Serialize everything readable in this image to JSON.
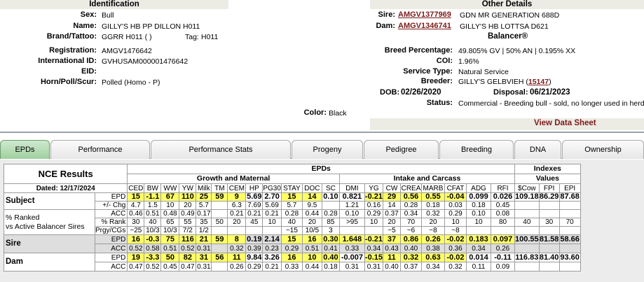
{
  "identification": {
    "header": "Identification",
    "rows": [
      {
        "label": "Sex:",
        "value": "Bull"
      },
      {
        "label": "Name:",
        "value": "GILLY'S HB PP DILLON H011"
      },
      {
        "label": "Brand/Tattoo:",
        "value": "GGRR H011 ( )",
        "tag_label": "Tag:",
        "tag_value": "H011"
      },
      {
        "label": "Registration:",
        "value": "AMGV1476642"
      },
      {
        "label": "International ID:",
        "value": "GVHUSAM000001476642"
      },
      {
        "label": "EID:",
        "value": ""
      },
      {
        "label": "Horn/Poll/Scur:",
        "value": "Polled (Homo - P)"
      }
    ],
    "color_label": "Color:",
    "color_value": "Black"
  },
  "other": {
    "header": "Other Details",
    "sire_label": "Sire:",
    "sire_id": "AMGV1377969",
    "sire_name": "GDN MR GENERATION 688D",
    "dam_label": "Dam:",
    "dam_id": "AMGV1346741",
    "dam_name": "GILLY'S HB LOTTSA D621",
    "breed_type": "Balancer®",
    "rows": [
      {
        "label": "Breed Percentage:",
        "value": "49.805% GV | 50% AN | 0.195% XX"
      },
      {
        "label": "COI:",
        "value": "1.96%"
      },
      {
        "label": "Service Type:",
        "value": "Natural Service"
      }
    ],
    "breeder_label": "Breeder:",
    "breeder_value": "GILLY'S GELBVIEH (",
    "breeder_link": "15147",
    "breeder_close": ")",
    "dob_label": "DOB:",
    "dob_value": "02/26/2020",
    "disposal_label": "Disposal:",
    "disposal_value": "06/21/2023",
    "status_label": "Status:",
    "status_value": "Commercial - Breeding bull - sold, no longer used in herd",
    "view_link": "View Data Sheet"
  },
  "tabs": [
    "EPDs",
    "Performance",
    "Performance Stats",
    "Progeny",
    "Pedigree",
    "Breeding",
    "DNA",
    "Ownership"
  ],
  "nce": {
    "title": "NCE Results",
    "dated": "Dated: 12/17/2024",
    "epds_header": "EPDs",
    "growth_header": "Growth and Maternal",
    "intake_header": "Intake and Carcass",
    "indexes_header": "Indexes",
    "values_header": "Values",
    "columns": [
      "CED",
      "BW",
      "WW",
      "YW",
      "Milk",
      "TM",
      "CEM",
      "HP",
      "PG30",
      "STAY",
      "DOC",
      "SC",
      "DMI",
      "YG",
      "CW",
      "CREA",
      "MARB",
      "CFAT",
      "ADG",
      "RFI",
      "$Cow",
      "FPI",
      "EPI"
    ],
    "subject_label": "Subject",
    "ranked_label1": "% Ranked",
    "ranked_label2": "vs Active Balancer Sires",
    "row_labels": {
      "epd": "EPD",
      "chg": "+/- Chg",
      "acc": "ACC",
      "rank": "% Rank",
      "prgy": "Prgy/CGs"
    },
    "subject": {
      "epd": [
        "15",
        "-1.1",
        "67",
        "110",
        "25",
        "59",
        "9",
        "5.69",
        "2.70",
        "15",
        "14",
        "0.10",
        "0.821",
        "-0.21",
        "29",
        "0.56",
        "0.55",
        "-0.04",
        "0.099",
        "0.026",
        "109.18",
        "86.29",
        "87.68"
      ],
      "chg": [
        "4.7",
        "1.5",
        "10",
        "20",
        "5.7",
        "",
        "6.3",
        "7.69",
        "5.69",
        "5.7",
        "9.5",
        "",
        "1.21",
        "0.16",
        "14",
        "0.28",
        "0.18",
        "0.03",
        "0.18",
        "0.45",
        "",
        "",
        ""
      ],
      "acc": [
        "0.46",
        "0.51",
        "0.48",
        "0.49",
        "0.17",
        "",
        "0.21",
        "0.21",
        "0.21",
        "0.28",
        "0.44",
        "0.28",
        "0.10",
        "0.29",
        "0.37",
        "0.34",
        "0.32",
        "0.29",
        "0.10",
        "0.08",
        "",
        "",
        ""
      ],
      "rank": [
        "30",
        "40",
        "65",
        "55",
        "35",
        "50",
        "20",
        "45",
        "10",
        "40",
        "20",
        "85",
        ">95",
        "10",
        "20",
        "70",
        "20",
        "10",
        "10",
        "80",
        "40",
        "30",
        "70"
      ],
      "prgy": [
        "~25",
        "10/3",
        "10/3",
        "7/2",
        "1/2",
        "",
        "",
        "",
        "",
        "~15",
        "10/5",
        "3",
        "",
        "",
        "~5",
        "~6",
        "~8",
        "~8",
        "",
        "",
        "",
        "",
        ""
      ],
      "highlight": [
        true,
        true,
        true,
        true,
        true,
        true,
        true,
        false,
        false,
        true,
        true,
        false,
        false,
        true,
        true,
        true,
        true,
        true,
        false,
        false,
        false,
        false,
        false
      ]
    },
    "sire": {
      "label": "Sire",
      "epd": [
        "16",
        "-0.3",
        "75",
        "116",
        "21",
        "59",
        "8",
        "0.19",
        "2.14",
        "15",
        "16",
        "0.30",
        "1.648",
        "-0.21",
        "37",
        "0.86",
        "0.26",
        "-0.02",
        "0.183",
        "0.097",
        "100.55",
        "81.58",
        "58.66"
      ],
      "acc": [
        "0.52",
        "0.58",
        "0.51",
        "0.52",
        "0.31",
        "",
        "0.32",
        "0.39",
        "0.23",
        "0.29",
        "0.51",
        "0.41",
        "0.33",
        "0.34",
        "0.43",
        "0.40",
        "0.38",
        "0.36",
        "0.34",
        "0.26",
        "",
        "",
        ""
      ],
      "highlight": [
        true,
        true,
        true,
        true,
        true,
        true,
        true,
        false,
        false,
        true,
        true,
        true,
        true,
        true,
        true,
        true,
        true,
        true,
        true,
        true,
        false,
        false,
        false
      ]
    },
    "dam": {
      "label": "Dam",
      "epd": [
        "19",
        "-3.3",
        "50",
        "82",
        "31",
        "56",
        "11",
        "9.84",
        "3.26",
        "16",
        "10",
        "0.40",
        "-0.007",
        "-0.15",
        "11",
        "0.32",
        "0.63",
        "-0.02",
        "0.014",
        "-0.11",
        "116.83",
        "81.40",
        "93.60"
      ],
      "acc": [
        "0.47",
        "0.52",
        "0.45",
        "0.47",
        "0.31",
        "",
        "0.26",
        "0.29",
        "0.21",
        "0.33",
        "0.44",
        "0.18",
        "0.31",
        "0.31",
        "0.40",
        "0.37",
        "0.34",
        "0.32",
        "0.11",
        "0.09",
        "",
        "",
        ""
      ],
      "highlight": [
        true,
        true,
        true,
        true,
        true,
        true,
        true,
        false,
        false,
        true,
        true,
        true,
        false,
        true,
        true,
        true,
        true,
        true,
        false,
        false,
        false,
        false,
        false
      ]
    }
  },
  "colors": {
    "link": "#7b1a1a",
    "highlight": "#ffff66",
    "active_tab": "#a8d8a8",
    "header_bg": "#ecebe4"
  }
}
